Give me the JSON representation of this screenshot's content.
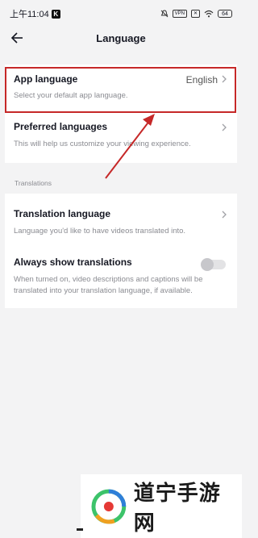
{
  "status_bar": {
    "time": "上午11:04",
    "vpn_label": "VPN",
    "battery": "64"
  },
  "header": {
    "title": "Language"
  },
  "settings": {
    "app_language": {
      "title": "App language",
      "value": "English",
      "description": "Select your default app language."
    },
    "preferred_languages": {
      "title": "Preferred languages",
      "description": "This will help us customize your viewing experience."
    }
  },
  "translations": {
    "section_label": "Translations",
    "translation_language": {
      "title": "Translation language",
      "description": "Language you'd like to have videos translated into."
    },
    "always_show": {
      "title": "Always show translations",
      "description": "When turned on, video descriptions and captions will be translated into your translation language, if available.",
      "enabled": false
    }
  },
  "watermark": {
    "text": "道宁手游网"
  },
  "colors": {
    "highlight": "#c62828",
    "background": "#f3f3f4",
    "card": "#ffffff"
  }
}
